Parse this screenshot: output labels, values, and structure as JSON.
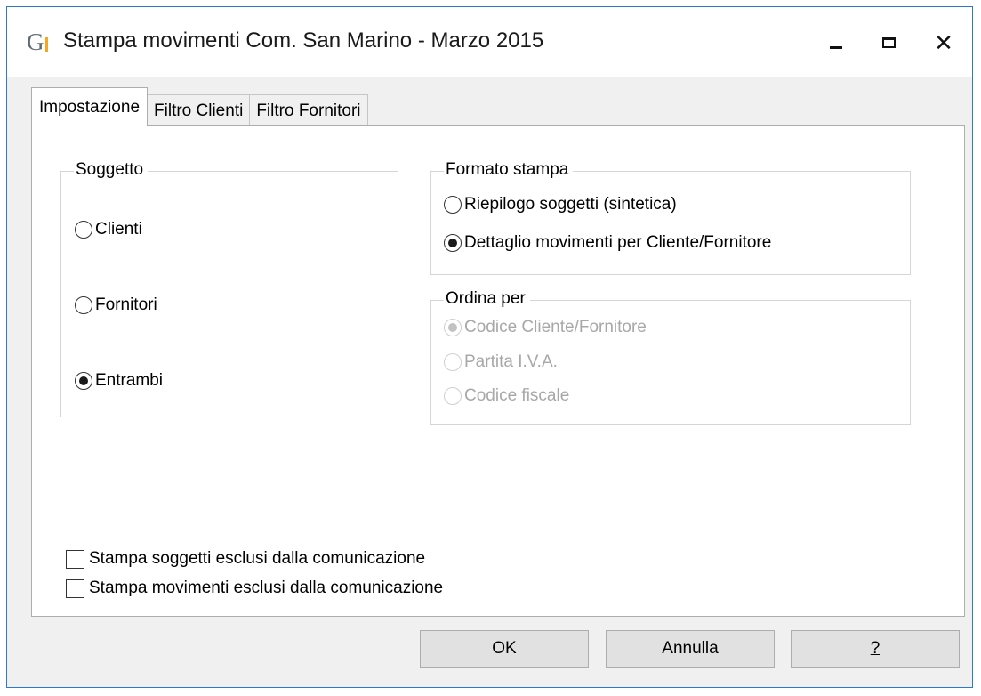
{
  "window": {
    "title": "Stampa movimenti Com. San Marino - Marzo 2015"
  },
  "tabs": [
    {
      "label": "Impostazione",
      "active": true
    },
    {
      "label": "Filtro Clienti",
      "active": false
    },
    {
      "label": "Filtro Fornitori",
      "active": false
    }
  ],
  "soggetto": {
    "title": "Soggetto",
    "options": [
      {
        "label": "Clienti",
        "checked": false
      },
      {
        "label": "Fornitori",
        "checked": false
      },
      {
        "label": "Entrambi",
        "checked": true
      }
    ]
  },
  "formato_stampa": {
    "title": "Formato stampa",
    "options": [
      {
        "label": "Riepilogo soggetti (sintetica)",
        "checked": false
      },
      {
        "label": "Dettaglio movimenti per Cliente/Fornitore",
        "checked": true
      }
    ]
  },
  "ordina_per": {
    "title": "Ordina per",
    "disabled": true,
    "options": [
      {
        "label": "Codice Cliente/Fornitore",
        "checked": true
      },
      {
        "label": "Partita I.V.A.",
        "checked": false
      },
      {
        "label": "Codice fiscale",
        "checked": false
      }
    ]
  },
  "checkboxes": [
    {
      "label": "Stampa soggetti esclusi dalla comunicazione",
      "checked": false
    },
    {
      "label": "Stampa movimenti esclusi dalla comunicazione",
      "checked": false
    }
  ],
  "buttons": {
    "ok": "OK",
    "cancel": "Annulla",
    "help": "?"
  }
}
